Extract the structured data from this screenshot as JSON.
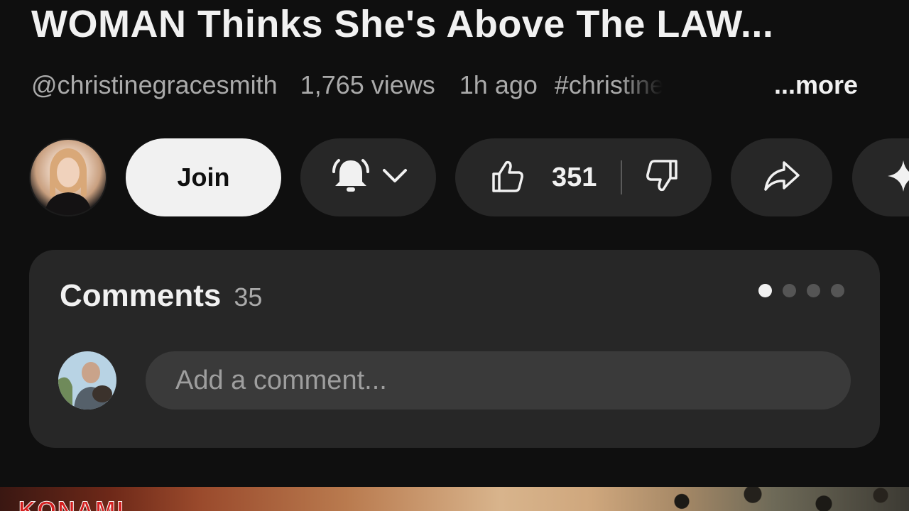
{
  "video": {
    "title": "WOMAN Thinks She's Above The LAW...",
    "channel_handle": "@christinegracesmith",
    "views": "1,765 views",
    "posted": "1h ago",
    "hashtag": "#christinegracesmith",
    "more_label": "...more"
  },
  "actions": {
    "join_label": "Join",
    "like_count": "351",
    "subscription_icon": "bell-icon",
    "like_icon": "thumbs-up-icon",
    "dislike_icon": "thumbs-down-icon",
    "share_icon": "share-arrow-icon",
    "remix_icon": "sparkle-icon"
  },
  "comments": {
    "label": "Comments",
    "count": "35",
    "placeholder": "Add a comment...",
    "pager_total": 4,
    "pager_active": 1
  },
  "next_video": {
    "brand_text": "KONAMI"
  },
  "colors": {
    "background": "#0f0f0f",
    "surface": "#272727",
    "text_primary": "#f1f1f1",
    "text_secondary": "#aaaaaa",
    "join_bg": "#f1f1f1"
  }
}
